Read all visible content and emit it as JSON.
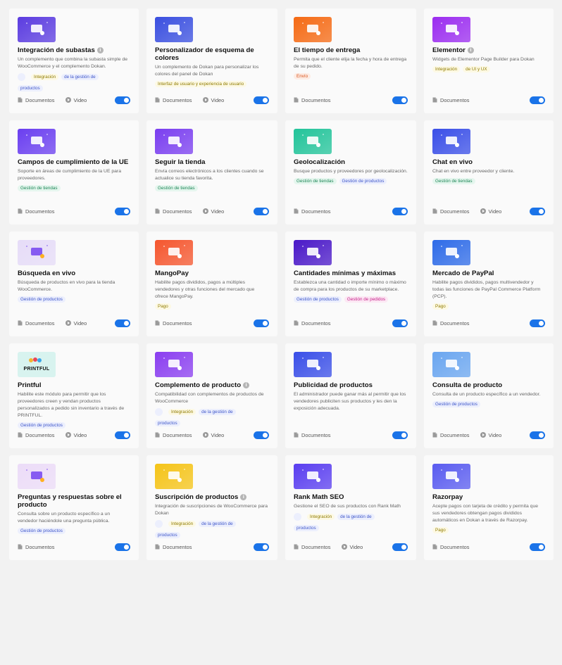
{
  "labels": {
    "docs": "Documentos",
    "video": "Video"
  },
  "colors": {
    "toggle_on": "#1a73e8"
  },
  "modules": [
    {
      "id": "auction",
      "title": "Integración de subastas",
      "info": true,
      "desc": "Un complemento que combina la subasta simple de WooCommerce y el complemento Dokan.",
      "thumb": "auction-icon",
      "thumbColor": "#5b3ce0",
      "tags": [
        {
          "style": "dot",
          "a": "Integración",
          "b": "de la gestión de",
          "c": "productos"
        }
      ],
      "video": true
    },
    {
      "id": "color-scheme",
      "title": "Personalizador de esquema de colores",
      "info": false,
      "desc": "Un complemento de Dokan para personalizar los colores del panel de Dokan",
      "thumb": "palette-icon",
      "thumbColor": "#3a4fe0",
      "tags": [
        {
          "style": "yellow",
          "text": "Interfaz de usuario y experiencia de usuario"
        }
      ],
      "video": true
    },
    {
      "id": "delivery-time",
      "title": "El tiempo de entrega",
      "info": false,
      "desc": "Permita que el cliente elija la fecha y hora de entrega de su pedido.",
      "thumb": "delivery-icon",
      "thumbColor": "#f56a14",
      "tags": [
        {
          "style": "orange",
          "text": "Envío"
        }
      ],
      "video": false
    },
    {
      "id": "elementor",
      "title": "Elementor",
      "info": true,
      "desc": "Widgets de Elementor Page Builder para Dokan",
      "thumb": "elementor-icon",
      "thumbColor": "#9b2cf0",
      "tags": [
        {
          "style": "yellowpair",
          "a": "Integración",
          "b": "de UI y UX"
        }
      ],
      "video": false
    },
    {
      "id": "eu-compliance",
      "title": "Campos de cumplimiento de la UE",
      "info": false,
      "desc": "Soporte en áreas de cumplimiento de la UE para proveedores.",
      "thumb": "eu-form-icon",
      "thumbColor": "#6a3ef0",
      "tags": [
        {
          "style": "green",
          "text": "Gestión de tiendas"
        }
      ],
      "video": false
    },
    {
      "id": "follow-store",
      "title": "Seguir la tienda",
      "info": false,
      "desc": "Envía correos electrónicos a los clientes cuando se actualice su tienda favorita.",
      "thumb": "store-follow-icon",
      "thumbColor": "#7a3ef0",
      "tags": [
        {
          "style": "green",
          "text": "Gestión de tiendas"
        }
      ],
      "video": true
    },
    {
      "id": "geolocation",
      "title": "Geolocalización",
      "info": false,
      "desc": "Busque productos y proveedores por geolocalización.",
      "thumb": "map-pin-icon",
      "thumbColor": "#22c49a",
      "tags": [
        {
          "style": "green",
          "text": "Gestión de tiendas"
        },
        {
          "style": "blue",
          "text": "Gestión de productos"
        }
      ],
      "video": false
    },
    {
      "id": "live-chat",
      "title": "Chat en vivo",
      "info": false,
      "desc": "Chat en vivo entre proveedor y cliente.",
      "thumb": "chat-icon",
      "thumbColor": "#3a4fe8",
      "tags": [
        {
          "style": "green",
          "text": "Gestión de tiendas"
        }
      ],
      "video": true
    },
    {
      "id": "live-search",
      "title": "Búsqueda en vivo",
      "info": false,
      "desc": "Búsqueda de productos en vivo para la tienda WooCommerce.",
      "thumb": "search-icon",
      "thumbColor": "#e6dcf8",
      "tags": [
        {
          "style": "blue",
          "text": "Gestión de productos"
        }
      ],
      "video": true
    },
    {
      "id": "mangopay",
      "title": "MangoPay",
      "info": false,
      "desc": "Habilite pagos divididos, pagos a múltiples vendedores y otras funciones del mercado que ofrece MangoPay.",
      "thumb": "mangopay-icon",
      "thumbColor": "#f5562e",
      "tags": [
        {
          "style": "yellow",
          "text": "Pago"
        }
      ],
      "video": false
    },
    {
      "id": "min-max",
      "title": "Cantidades mínimas y máximas",
      "info": false,
      "desc": "Establezca una cantidad o importe mínimo o máximo de compra para los productos de su marketplace.",
      "thumb": "min-max-icon",
      "thumbColor": "#4a18c8",
      "tags": [
        {
          "style": "blue",
          "text": "Gestión de productos"
        },
        {
          "style": "pink",
          "text": "Gestión de pedidos"
        }
      ],
      "video": false
    },
    {
      "id": "paypal",
      "title": "Mercado de PayPal",
      "info": false,
      "desc": "Habilite pagos divididos, pagos multivendedor y todas las funciones de PayPal Commerce Platform (PCP).",
      "thumb": "paypal-icon",
      "thumbColor": "#2e6be8",
      "tags": [
        {
          "style": "yellow",
          "text": "Pago"
        }
      ],
      "video": false
    },
    {
      "id": "printful",
      "title": "Printful",
      "info": false,
      "desc": "Habilite este módulo para permitir que los proveedores creen y vendan productos personalizados a pedido sin inventario a través de PRINTFUL.",
      "thumb": "printful-logo",
      "thumbColor": "#d8f3ef",
      "thumbText": "PRINTFUL",
      "tags": [
        {
          "style": "blue",
          "text": "Gestión de productos"
        }
      ],
      "video": true
    },
    {
      "id": "product-addon",
      "title": "Complemento de producto",
      "info": true,
      "desc": "Compatibilidad con complementos de productos de WooCommerce",
      "thumb": "gift-box-icon",
      "thumbColor": "#8a3ef0",
      "tags": [
        {
          "style": "dot",
          "a": "Integración",
          "b": "de la gestión de",
          "c": "productos"
        }
      ],
      "video": true
    },
    {
      "id": "product-ads",
      "title": "Publicidad de productos",
      "info": false,
      "desc": "El administrador puede ganar más al permitir que los vendedores publiciten sus productos y les den la exposición adecuada.",
      "thumb": "megaphone-icon",
      "thumbColor": "#3a4fe8",
      "tags": [],
      "video": false
    },
    {
      "id": "product-enquiry",
      "title": "Consulta de producto",
      "info": false,
      "desc": "Consulta de un producto específico a un vendedor.",
      "thumb": "enquiry-icon",
      "thumbColor": "#6aa6f0",
      "tags": [
        {
          "style": "blue",
          "text": "Gestión de productos"
        }
      ],
      "video": true
    },
    {
      "id": "qa",
      "title": "Preguntas y respuestas sobre el producto",
      "info": false,
      "desc": "Consulta sobre un producto específico a un vendedor haciéndole una pregunta pública.",
      "thumb": "qa-icon",
      "thumbColor": "#ecdcf8",
      "tags": [
        {
          "style": "blue",
          "text": "Gestión de productos"
        }
      ],
      "video": false
    },
    {
      "id": "subscription",
      "title": "Suscripción de productos",
      "info": true,
      "desc": "Integración de suscripciones de WooCommerce para Dokan",
      "thumb": "subscription-icon",
      "thumbColor": "#f5c418",
      "tags": [
        {
          "style": "dot",
          "a": "Integración",
          "b": "de la gestión de",
          "c": "productos"
        }
      ],
      "video": false
    },
    {
      "id": "rank-math",
      "title": "Rank Math SEO",
      "info": false,
      "desc": "Gestione el SEO de sus productos con Rank Math",
      "thumb": "rank-math-icon",
      "thumbColor": "#5a3ef0",
      "tags": [
        {
          "style": "dot",
          "a": "Integración",
          "b": "de la gestión de",
          "c": "productos"
        }
      ],
      "video": true
    },
    {
      "id": "razorpay",
      "title": "Razorpay",
      "info": false,
      "desc": "Acepte pagos con tarjeta de crédito y permita que sus vendedores obtengan pagos divididos automáticos en Dokan a través de Razorpay.",
      "thumb": "razorpay-icon",
      "thumbColor": "#5a5cf0",
      "tags": [
        {
          "style": "yellow",
          "text": "Pago"
        }
      ],
      "video": false
    }
  ]
}
